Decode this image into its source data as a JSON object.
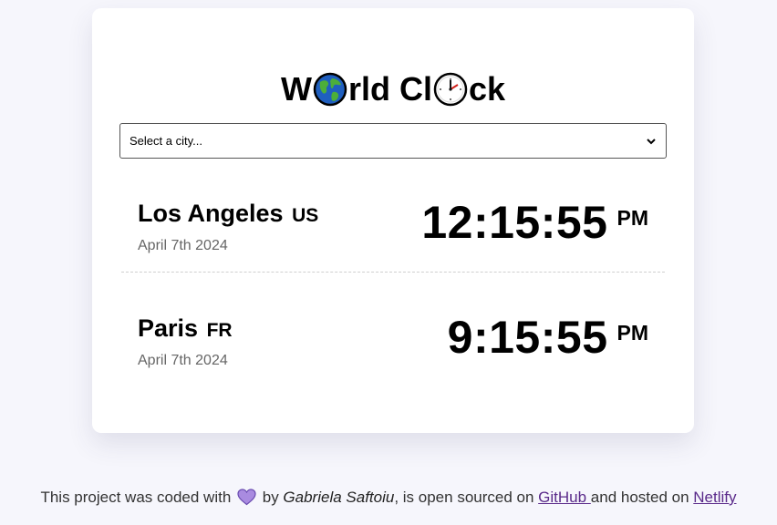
{
  "title": {
    "before": "W",
    "middle": "rld Cl",
    "after": "ck",
    "icons": [
      "globe-icon",
      "clock-icon"
    ]
  },
  "city_select": {
    "value": "Select a city..."
  },
  "cities": [
    {
      "name": "Los Angeles",
      "country": "US",
      "date": "April 7th 2024",
      "time": "12:15:55",
      "ampm": "PM"
    },
    {
      "name": "Paris",
      "country": "FR",
      "date": "April 7th 2024",
      "time": "9:15:55",
      "ampm": "PM"
    }
  ],
  "footer": {
    "text1": "This project was coded with ",
    "text2": " by ",
    "author": "Gabriela Saftoiu",
    "text3": ", is open sourced on ",
    "github_label": "GitHub ",
    "text4": "and hosted on ",
    "netlify_label": "Netlify",
    "heart_icon": "purple-heart-icon"
  },
  "colors": {
    "background": "#f6f6fc",
    "card": "#ffffff",
    "link": "#5a2a8a",
    "heart": "#a98be0"
  }
}
